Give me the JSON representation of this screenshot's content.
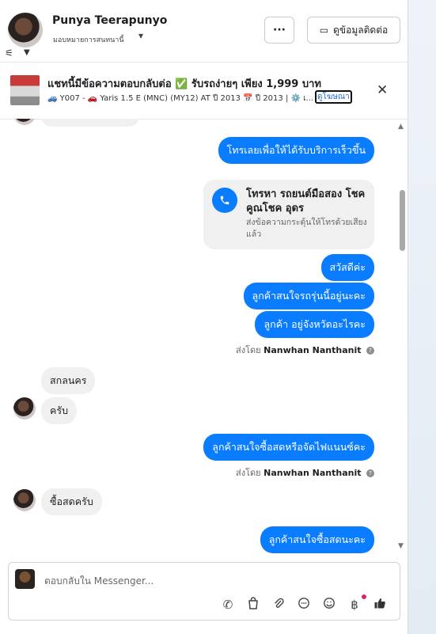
{
  "header": {
    "name": "Punya Teerapunyo",
    "assign_label": "มอบหมายการสนทนานี้",
    "more_label": "···",
    "contact_label": "ดูข้อมูลติดต่อ"
  },
  "banner": {
    "title": "แชทนี้มีข้อความตอบกลับต่อ ✅ รับรถง่ายๆ เพียง 1,999 บาท",
    "subtitle": "🚙 Y007 - 🚗 Yaris 1.5 E (MNC) (MY12) AT ปี 2013 📅 ปี 2013 | ⚙️ เ...",
    "ad_link": "ดูโฆษณา",
    "close": "✕"
  },
  "chat": {
    "m1": "โทรเลยเพื่อให้ได้รับบริการเร็วขึ้น",
    "call_title": "โทรหา รถยนต์มือสอง โชคคูณโชค อุดร",
    "call_sub": "ส่งข้อความกระตุ้นให้โทรด้วยเสียงแล้ว",
    "m2": "สวัสดีค่ะ",
    "m3": "ลูกค้าสนใจรถรุ่นนี้อยู่นะคะ",
    "m4": "ลูกค้า อยู่จังหวัดอะไรคะ",
    "sent_prefix": "ส่งโดย",
    "sender": "Nanwhan Nanthanit",
    "r1": "สกลนคร",
    "r2": "ครับ",
    "m5": "ลูกค้าสนใจซื้อสดหรือจัดไฟแนนซ์คะ",
    "r3": "ซื้อสดครับ",
    "m6": "ลูกค้าสนใจซื้อสดนะคะ"
  },
  "composer": {
    "placeholder": "ตอบกลับใน Messenger..."
  },
  "colors": {
    "accent": "#0a7cff",
    "incoming": "#f0f0f0"
  }
}
